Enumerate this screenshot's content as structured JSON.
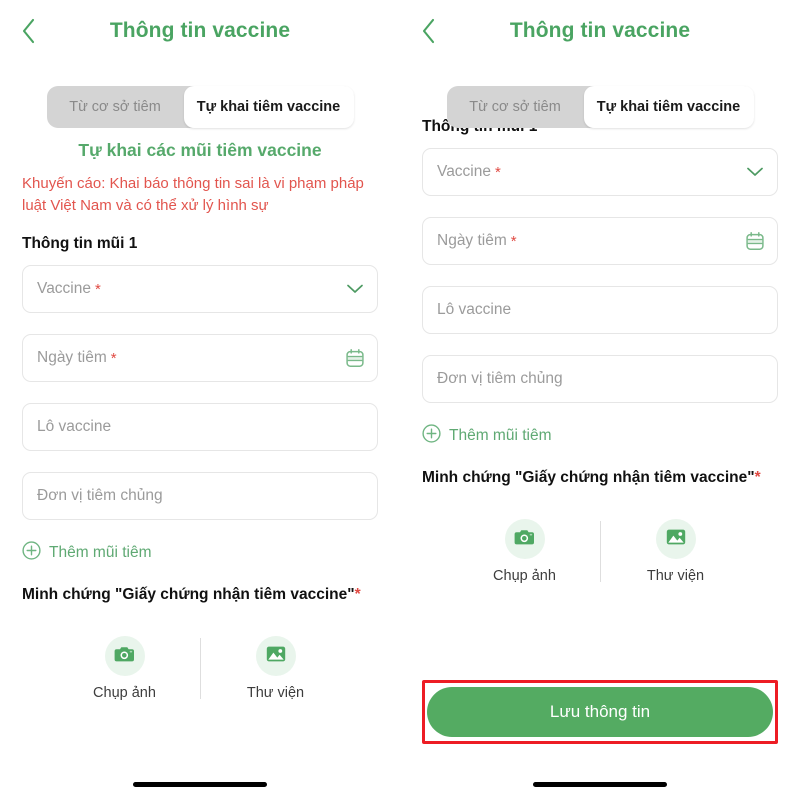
{
  "header": {
    "title": "Thông tin vaccine",
    "back_icon": "chevron-left-icon",
    "title_color": "#4aa462"
  },
  "tabs": {
    "items": [
      {
        "label": "Từ cơ sở tiêm",
        "active": false
      },
      {
        "label": "Tự khai tiêm vaccine",
        "active": true
      }
    ],
    "track_color": "#d4d4d4",
    "active_bg": "#ffffff"
  },
  "left_screen": {
    "section_heading": "Tự khai các mũi tiêm vaccine",
    "warning": "Khuyến cáo: Khai báo thông tin sai là vi phạm pháp luật Việt Nam và có thể xử lý hình sự",
    "warning_color": "#e2554e",
    "dose_label": "Thông tin mũi 1",
    "fields": [
      {
        "placeholder": "Vaccine",
        "required": true,
        "trailing_icon": "chevron-down-icon"
      },
      {
        "placeholder": "Ngày tiêm",
        "required": true,
        "trailing_icon": "calendar-icon"
      },
      {
        "placeholder": "Lô vaccine",
        "required": false,
        "trailing_icon": ""
      },
      {
        "placeholder": "Đơn vị tiêm chủng",
        "required": false,
        "trailing_icon": ""
      }
    ],
    "add_dose": {
      "label": "Thêm mũi tiêm",
      "icon": "plus-circle-icon"
    },
    "proof_title": "Minh chứng \"Giấy chứng nhận tiêm vaccine\"",
    "proof_required_mark": "*",
    "media": [
      {
        "label": "Chụp ảnh",
        "icon": "camera-icon"
      },
      {
        "label": "Thư viện",
        "icon": "image-icon"
      }
    ]
  },
  "right_screen": {
    "dose_label": "Thông tin mũi 1",
    "fields": [
      {
        "placeholder": "Vaccine",
        "required": true,
        "trailing_icon": "chevron-down-icon"
      },
      {
        "placeholder": "Ngày tiêm",
        "required": true,
        "trailing_icon": "calendar-icon"
      },
      {
        "placeholder": "Lô vaccine",
        "required": false,
        "trailing_icon": ""
      },
      {
        "placeholder": "Đơn vị tiêm chủng",
        "required": false,
        "trailing_icon": ""
      }
    ],
    "add_dose": {
      "label": "Thêm mũi tiêm",
      "icon": "plus-circle-icon"
    },
    "proof_title": "Minh chứng \"Giấy chứng nhận tiêm vaccine\"",
    "proof_required_mark": "*",
    "media": [
      {
        "label": "Chụp ảnh",
        "icon": "camera-icon"
      },
      {
        "label": "Thư viện",
        "icon": "image-icon"
      }
    ],
    "save_button": {
      "label": "Lưu thông tin",
      "color": "#54ab62",
      "highlight_color": "#ed1c24"
    }
  },
  "required_mark": "*"
}
